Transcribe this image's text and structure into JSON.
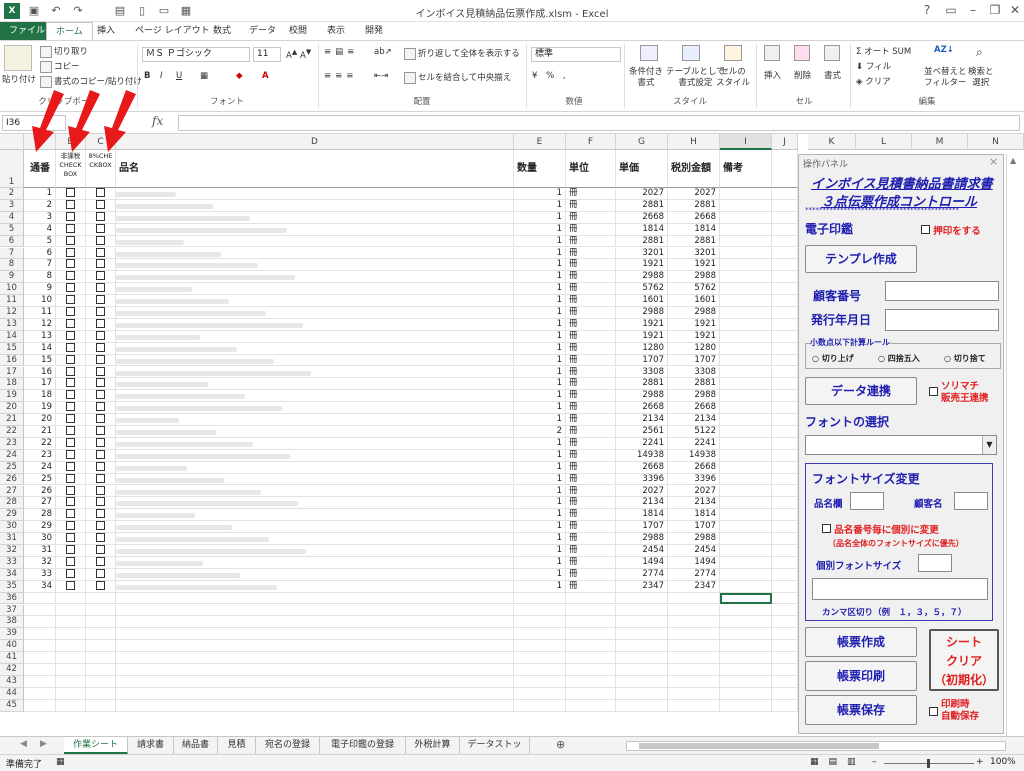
{
  "window": {
    "title": "インボイス見積納品伝票作成.xlsm - Excel"
  },
  "tabs": [
    "ファイル",
    "ホーム",
    "挿入",
    "ページ レイアウト",
    "数式",
    "データ",
    "校閲",
    "表示",
    "開発"
  ],
  "ribbon": {
    "clipboard": {
      "paste": "貼り付け",
      "cut": "切り取り",
      "copy": "コピー",
      "format_painter": "書式のコピー/貼り付け",
      "group": "クリップボード"
    },
    "font": {
      "name": "ＭＳ Ｐゴシック",
      "size": "11",
      "group": "フォント"
    },
    "alignment": {
      "wrap": "折り返して全体を表示する",
      "merge": "セルを結合して中央揃え",
      "group": "配置"
    },
    "number": {
      "format": "標準",
      "group": "数値"
    },
    "styles": {
      "conditional": "条件付き\n書式",
      "table": "テーブルとして\n書式設定",
      "cell": "セルの\nスタイル",
      "group": "スタイル"
    },
    "cells": {
      "insert": "挿入",
      "delete": "削除",
      "format": "書式",
      "group": "セル"
    },
    "editing": {
      "autosum": "オート SUM",
      "fill": "フィル",
      "clear": "クリア",
      "sort": "並べ替えと\nフィルター",
      "find": "検索と\n選択",
      "group": "編集"
    }
  },
  "formula_bar": {
    "name_box": "I36",
    "fx": "fx",
    "content": ""
  },
  "columns": [
    "A",
    "B",
    "C",
    "D",
    "E",
    "F",
    "G",
    "H",
    "I",
    "J",
    "K",
    "L",
    "M",
    "N"
  ],
  "headers": {
    "a": "通番",
    "b": "非課税\nCHECK\nBOX",
    "c": "8%CHE\nCKBOX",
    "d": "品名",
    "e": "数量",
    "f": "単位",
    "g": "単価",
    "h": "税別金額",
    "i": "備考"
  },
  "rows": [
    {
      "no": "1",
      "qty": "1",
      "unit": "冊",
      "price": "2027",
      "amount": "2027"
    },
    {
      "no": "2",
      "qty": "1",
      "unit": "冊",
      "price": "2881",
      "amount": "2881"
    },
    {
      "no": "3",
      "qty": "1",
      "unit": "冊",
      "price": "2668",
      "amount": "2668"
    },
    {
      "no": "4",
      "qty": "1",
      "unit": "冊",
      "price": "1814",
      "amount": "1814"
    },
    {
      "no": "5",
      "qty": "1",
      "unit": "冊",
      "price": "2881",
      "amount": "2881"
    },
    {
      "no": "6",
      "qty": "1",
      "unit": "冊",
      "price": "3201",
      "amount": "3201"
    },
    {
      "no": "7",
      "qty": "1",
      "unit": "冊",
      "price": "1921",
      "amount": "1921"
    },
    {
      "no": "8",
      "qty": "1",
      "unit": "冊",
      "price": "2988",
      "amount": "2988"
    },
    {
      "no": "9",
      "qty": "1",
      "unit": "冊",
      "price": "5762",
      "amount": "5762"
    },
    {
      "no": "10",
      "qty": "1",
      "unit": "冊",
      "price": "1601",
      "amount": "1601"
    },
    {
      "no": "11",
      "qty": "1",
      "unit": "冊",
      "price": "2988",
      "amount": "2988"
    },
    {
      "no": "12",
      "qty": "1",
      "unit": "冊",
      "price": "1921",
      "amount": "1921"
    },
    {
      "no": "13",
      "qty": "1",
      "unit": "冊",
      "price": "1921",
      "amount": "1921"
    },
    {
      "no": "14",
      "qty": "1",
      "unit": "冊",
      "price": "1280",
      "amount": "1280"
    },
    {
      "no": "15",
      "qty": "1",
      "unit": "冊",
      "price": "1707",
      "amount": "1707"
    },
    {
      "no": "16",
      "qty": "1",
      "unit": "冊",
      "price": "3308",
      "amount": "3308"
    },
    {
      "no": "17",
      "qty": "1",
      "unit": "冊",
      "price": "2881",
      "amount": "2881"
    },
    {
      "no": "18",
      "qty": "1",
      "unit": "冊",
      "price": "2988",
      "amount": "2988"
    },
    {
      "no": "19",
      "qty": "1",
      "unit": "冊",
      "price": "2668",
      "amount": "2668"
    },
    {
      "no": "20",
      "qty": "1",
      "unit": "冊",
      "price": "2134",
      "amount": "2134"
    },
    {
      "no": "21",
      "qty": "2",
      "unit": "冊",
      "price": "2561",
      "amount": "5122"
    },
    {
      "no": "22",
      "qty": "1",
      "unit": "冊",
      "price": "2241",
      "amount": "2241"
    },
    {
      "no": "23",
      "qty": "1",
      "unit": "冊",
      "price": "14938",
      "amount": "14938"
    },
    {
      "no": "24",
      "qty": "1",
      "unit": "冊",
      "price": "2668",
      "amount": "2668"
    },
    {
      "no": "25",
      "qty": "1",
      "unit": "冊",
      "price": "3396",
      "amount": "3396"
    },
    {
      "no": "26",
      "qty": "1",
      "unit": "冊",
      "price": "2027",
      "amount": "2027"
    },
    {
      "no": "27",
      "qty": "1",
      "unit": "冊",
      "price": "2134",
      "amount": "2134"
    },
    {
      "no": "28",
      "qty": "1",
      "unit": "冊",
      "price": "1814",
      "amount": "1814"
    },
    {
      "no": "29",
      "qty": "1",
      "unit": "冊",
      "price": "1707",
      "amount": "1707"
    },
    {
      "no": "30",
      "qty": "1",
      "unit": "冊",
      "price": "2988",
      "amount": "2988"
    },
    {
      "no": "31",
      "qty": "1",
      "unit": "冊",
      "price": "2454",
      "amount": "2454"
    },
    {
      "no": "32",
      "qty": "1",
      "unit": "冊",
      "price": "1494",
      "amount": "1494"
    },
    {
      "no": "33",
      "qty": "1",
      "unit": "冊",
      "price": "2774",
      "amount": "2774"
    },
    {
      "no": "34",
      "qty": "1",
      "unit": "冊",
      "price": "2347",
      "amount": "2347"
    }
  ],
  "row_numbers": [
    "1",
    "2",
    "3",
    "4",
    "5",
    "6",
    "7",
    "8",
    "9",
    "10",
    "11",
    "12",
    "13",
    "14",
    "15",
    "16",
    "17",
    "18",
    "19",
    "20",
    "21",
    "22",
    "23",
    "24",
    "25",
    "26",
    "27",
    "28",
    "29",
    "30",
    "31",
    "32",
    "33",
    "34",
    "35",
    "36",
    "37",
    "38",
    "39",
    "40",
    "41",
    "42",
    "43",
    "44",
    "45"
  ],
  "panel": {
    "title": "操作パネル",
    "close": "×",
    "heading1": "インボイス見積書納品書請求書",
    "heading2": "３点伝票作成コントロール",
    "stars": "********************************************",
    "stamp_label": "電子印鑑",
    "stamp_check": "押印をする",
    "template_btn": "テンプレ作成",
    "customer_no": "顧客番号",
    "issue_date": "発行年月日",
    "rounding_title": "小数点以下計算ルール",
    "round_up": "切り上げ",
    "round_half": "四捨五入",
    "round_down": "切り捨て",
    "data_link_btn": "データ連携",
    "sorimachi": "ソリマチ\n販売王連携",
    "font_select": "フォントの選択",
    "font_size_title": "フォントサイズ変更",
    "item_col": "品名欄",
    "customer_name": "顧客名",
    "per_item": "品名番号毎に個別に変更",
    "per_item_note": "（品名全体のフォントサイズに優先）",
    "indiv_size": "個別フォントサイズ",
    "comma_note": "カンマ区切り（例　１，３，５，７）",
    "make_btn": "帳票作成",
    "print_btn": "帳票印刷",
    "save_btn": "帳票保存",
    "clear_btn": "シート\nクリア\n（初期化）",
    "autosave": "印刷時\n自動保存"
  },
  "sheet_tabs": [
    "作業シート",
    "請求書",
    "納品書",
    "見積書",
    "宛名の登録",
    "電子印鑑の登録",
    "外税計算",
    "データストック"
  ],
  "status": {
    "ready": "準備完了",
    "zoom": "100%"
  }
}
